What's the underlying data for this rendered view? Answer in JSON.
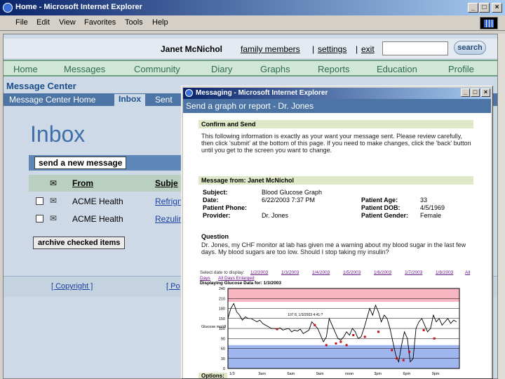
{
  "window": {
    "title": "Home - Microsoft Internet Explorer"
  },
  "menu": [
    "File",
    "Edit",
    "View",
    "Favorites",
    "Tools",
    "Help"
  ],
  "user": {
    "name": "Janet McNichol",
    "links": [
      "family members",
      "settings",
      "exit"
    ],
    "search_button": "search"
  },
  "nav": [
    "Home",
    "Messages",
    "Community",
    "Diary",
    "Graphs",
    "Reports",
    "Education",
    "Profile"
  ],
  "message_center": {
    "title": "Message Center",
    "tabs": [
      "Message Center Home",
      "Inbox",
      "Sent"
    ],
    "inbox_heading": "Inbox",
    "new_message": "send a new message",
    "columns": {
      "from": "From",
      "subject": "Subje"
    },
    "rows": [
      {
        "from": "ACME Health",
        "subject": "Refrign"
      },
      {
        "from": "ACME Health",
        "subject": "Rezulin"
      }
    ],
    "archive": "archive checked items",
    "footer": [
      "[ Copyright ]",
      "[ Po"
    ]
  },
  "popup": {
    "window_title": "Messaging - Microsoft Internet Explorer",
    "heading": "Send a graph or report - Dr. Jones",
    "confirm": {
      "title": "Confirm and Send",
      "text": "This following information is exactly as your want your message sent. Please review carefully, then click 'submit' at the bottom of this page. If you need to make changes, click the 'back' button until you get to the screen you want to change."
    },
    "message": {
      "title": "Message from: Janet McNichol",
      "subject_label": "Subject:",
      "subject": "Blood Glucose Graph",
      "date_label": "Date:",
      "date": "6/22/2003 7:37 PM",
      "phone_label": "Patient Phone:",
      "phone": "",
      "provider_label": "Provider:",
      "provider": "Dr. Jones",
      "age_label": "Patient Age:",
      "age": "33",
      "dob_label": "Patient DOB:",
      "dob": "4/5/1969",
      "gender_label": "Patient Gender:",
      "gender": "Female"
    },
    "question": {
      "title": "Question",
      "text": "Dr. Jones, my CHF monitor at lab has given me a warning about my blood sugar in the last few days. My blood sugars are too low. Should I stop taking my insulin?"
    },
    "date_links_label": "Select date to display:",
    "date_links": [
      "1/2/2003",
      "1/3/2003",
      "1/4/2003",
      "1/5/2003",
      "1/6/2003",
      "1/7/2003",
      "1/8/2003",
      "All"
    ],
    "days_label": "Days",
    "all_days_label": "All Days Enlarged",
    "displaying": "Displaying Glucose Data for: 1/3/2003",
    "options_label": "Options:"
  },
  "chart_data": {
    "type": "line",
    "title": "Displaying Glucose Data for: 1/3/2003",
    "ylabel": "Glucose mg/dl",
    "ylim": [
      0,
      240
    ],
    "yticks": [
      0,
      30,
      60,
      90,
      120,
      150,
      180,
      210,
      240
    ],
    "xticks": [
      "1/3",
      "3am",
      "6am",
      "9am",
      "noon",
      "3pm",
      "6pm",
      "9pm"
    ],
    "xlim": [
      0,
      24
    ],
    "annotation": "107 8, 1/3/2003 4:41:?",
    "series": [
      {
        "name": "Glucose",
        "x": [
          0,
          0.3,
          0.6,
          0.9,
          1.2,
          1.5,
          1.8,
          2.1,
          2.4,
          2.7,
          3.0,
          3.3,
          3.6,
          3.9,
          4.2,
          4.5,
          4.8,
          5.1,
          5.4,
          5.7,
          6.0,
          6.3,
          6.6,
          6.9,
          7.2,
          7.5,
          7.8,
          8.1,
          8.4,
          8.7,
          9.0,
          9.3,
          9.6,
          9.9,
          10.2,
          10.5,
          10.8,
          11.1,
          11.4,
          11.7,
          12.0,
          12.3,
          12.6,
          12.9,
          13.2,
          13.5,
          13.8,
          14.1,
          14.4,
          14.7,
          15.0,
          15.3,
          15.6,
          15.9,
          16.2,
          16.5,
          16.8,
          17.1,
          17.4,
          17.7,
          18.0,
          18.3,
          18.6,
          18.9,
          19.2,
          19.5,
          19.8,
          20.1,
          20.4,
          20.7,
          21.0,
          21.3,
          21.6,
          21.9,
          22.2,
          22.5,
          22.8,
          23.1,
          23.4,
          23.7
        ],
        "y": [
          150,
          180,
          195,
          170,
          160,
          145,
          155,
          150,
          150,
          145,
          140,
          145,
          135,
          130,
          125,
          120,
          120,
          118,
          122,
          115,
          118,
          120,
          110,
          115,
          112,
          118,
          105,
          110,
          115,
          140,
          130,
          120,
          100,
          80,
          95,
          150,
          130,
          110,
          90,
          85,
          95,
          110,
          100,
          120,
          110,
          90,
          95,
          120,
          150,
          180,
          160,
          190,
          170,
          140,
          160,
          150,
          120,
          80,
          40,
          20,
          70,
          110,
          90,
          20,
          30,
          120,
          140,
          150,
          130,
          110,
          120,
          160,
          140,
          150,
          130,
          140,
          150,
          135,
          145,
          140
        ]
      }
    ],
    "markers": {
      "x": [
        5.1,
        9.0,
        10.2,
        11.2,
        11.7,
        12.3,
        13.0,
        14.2,
        15.6,
        17.0,
        17.5,
        18.2,
        18.8,
        20.3,
        21.4
      ],
      "y": [
        118,
        130,
        70,
        75,
        80,
        70,
        100,
        95,
        110,
        55,
        30,
        25,
        50,
        115,
        90
      ]
    },
    "bands": [
      {
        "name": "high",
        "from": 200,
        "to": 240,
        "color": "#f7b6c2"
      },
      {
        "name": "target",
        "from": 70,
        "to": 180,
        "color": "#ffffff"
      },
      {
        "name": "low",
        "from": 0,
        "to": 70,
        "color": "#9fb6ee"
      }
    ],
    "grid": true
  }
}
